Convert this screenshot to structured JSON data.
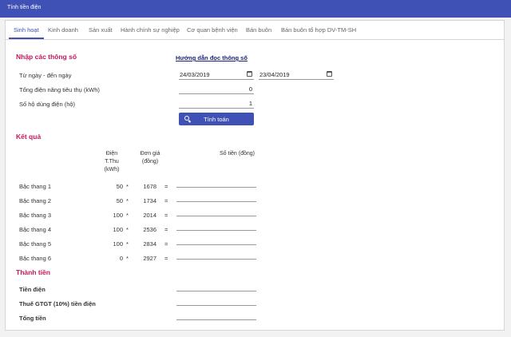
{
  "window": {
    "title": "Tính tiền điện"
  },
  "tabs": [
    {
      "label": "Sinh hoạt",
      "active": true
    },
    {
      "label": "Kinh doanh"
    },
    {
      "label": "Sản xuất"
    },
    {
      "label": "Hành chính sự nghiệp"
    },
    {
      "label": "Cơ quan bệnh viện"
    },
    {
      "label": "Bán buôn"
    },
    {
      "label": "Bán buôn tổ hợp DV-TM-SH"
    }
  ],
  "input": {
    "title": "Nhập các thông số",
    "guide_link": "Hướng dẫn đọc thông số",
    "date_range_label": "Từ ngày - đến ngày",
    "from_date": "24/03/2019",
    "to_date": "23/04/2019",
    "kwh_label": "Tổng điện năng tiêu thụ (kWh)",
    "kwh_value": "0",
    "households_label": "Số hộ dùng điện (hộ)",
    "households_value": "1",
    "calculate_button": "Tính toán"
  },
  "result": {
    "title": "Kết quả",
    "col_kwh": [
      "Điện",
      "T.Thu",
      "(kWh)"
    ],
    "col_price": [
      "Đơn giá",
      "(đồng)"
    ],
    "col_amount": "Số tiền (đồng)",
    "rows": [
      {
        "tier": "Bậc thang 1",
        "kwh": "50",
        "mul": "*",
        "price": "1678",
        "eq": "="
      },
      {
        "tier": "Bậc thang 2",
        "kwh": "50",
        "mul": "*",
        "price": "1734",
        "eq": "="
      },
      {
        "tier": "Bậc thang 3",
        "kwh": "100",
        "mul": "*",
        "price": "2014",
        "eq": "="
      },
      {
        "tier": "Bậc thang 4",
        "kwh": "100",
        "mul": "*",
        "price": "2536",
        "eq": "="
      },
      {
        "tier": "Bậc thang 5",
        "kwh": "100",
        "mul": "*",
        "price": "2834",
        "eq": "="
      },
      {
        "tier": "Bậc thang 6",
        "kwh": "0",
        "mul": "*",
        "price": "2927",
        "eq": "="
      }
    ]
  },
  "total": {
    "title": "Thành tiền",
    "electricity_label": "Tiền điện",
    "vat_label": "Thuế GTGT (10%) tiền điện",
    "total_label": "Tổng tiền"
  },
  "colors": {
    "primary": "#3f51b5",
    "section": "#c2185b",
    "link": "#1a237e"
  }
}
